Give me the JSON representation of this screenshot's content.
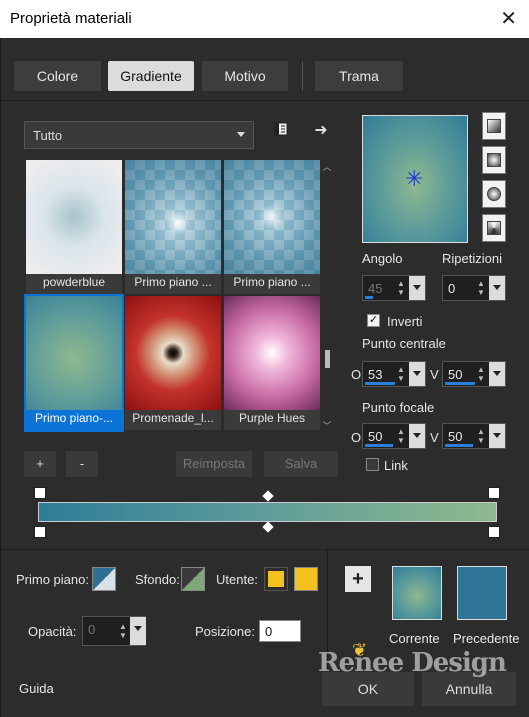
{
  "window": {
    "title": "Proprietà materiali",
    "close_glyph": "✕"
  },
  "tabs": [
    "Colore",
    "Gradiente",
    "Motivo",
    "Trama"
  ],
  "library": {
    "dropdown_value": "Tutto",
    "items": [
      {
        "label": "powderblue"
      },
      {
        "label": "Primo piano ..."
      },
      {
        "label": "Primo piano ..."
      },
      {
        "label": "Primo piano-..."
      },
      {
        "label": "Promenade_l..."
      },
      {
        "label": "Purple Hues"
      }
    ],
    "selected_index": 3,
    "add_label": "+",
    "remove_label": "-",
    "reset_label": "Reimposta",
    "save_label": "Salva"
  },
  "style": {
    "angle_label": "Angolo",
    "angle_value": "45",
    "repeat_label": "Ripetizioni",
    "repeat_value": "0",
    "invert_label": "Inverti",
    "invert_checked": true,
    "center_label": "Punto centrale",
    "center_o_label": "O",
    "center_o_value": "53",
    "center_v_label": "V",
    "center_v_value": "50",
    "focal_label": "Punto focale",
    "focal_o_label": "O",
    "focal_o_value": "50",
    "focal_v_label": "V",
    "focal_v_value": "50",
    "link_label": "Link",
    "link_checked": false
  },
  "bottom": {
    "foreground_label": "Primo piano:",
    "background_label": "Sfondo:",
    "user_label": "Utente:",
    "user_color": "#f2c11f",
    "opacity_label": "Opacità:",
    "opacity_value": "0",
    "position_label": "Posizione:",
    "position_value": "0",
    "current_label": "Corrente",
    "previous_label": "Precedente",
    "help_label": "Guida",
    "ok_label": "OK",
    "cancel_label": "Annulla",
    "watermark": "Renee Design"
  },
  "colors": {
    "gradient_start": "#2f7c98",
    "gradient_mid": "#5f9d9a",
    "gradient_end": "#8fb98e",
    "selection": "#0a74d6",
    "previous": "#2f7495"
  }
}
